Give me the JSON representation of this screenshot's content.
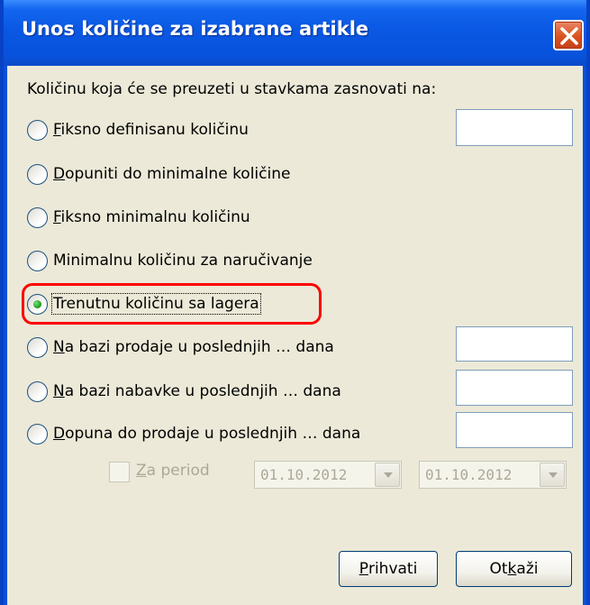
{
  "window": {
    "title": "Unos količine za izabrane artikle"
  },
  "header": {
    "label": "Količinu koja će se preuzeti u stavkama zasnovati na:"
  },
  "options": [
    {
      "mnemonic": "F",
      "rest": "iksno definisanu količinu",
      "selected": false,
      "has_input": true,
      "input_value": ""
    },
    {
      "mnemonic": "D",
      "rest": "opuniti do minimalne količine",
      "selected": false,
      "has_input": false
    },
    {
      "mnemonic": "F",
      "rest": "iksno minimalnu količinu",
      "selected": false,
      "has_input": false
    },
    {
      "mnemonic": "",
      "rest": "Minimalnu količinu za naručivanje",
      "selected": false,
      "has_input": false
    },
    {
      "mnemonic": "",
      "rest": "Trenutnu količinu sa lagera",
      "selected": true,
      "has_input": false
    },
    {
      "mnemonic": "N",
      "rest": "a bazi prodaje u poslednjih … dana",
      "selected": false,
      "has_input": true,
      "input_value": ""
    },
    {
      "mnemonic": "N",
      "rest": "a bazi nabavke u poslednjih … dana",
      "selected": false,
      "has_input": true,
      "input_value": ""
    },
    {
      "mnemonic": "D",
      "rest": "opuna do prodaje u poslednjih … dana",
      "selected": false,
      "has_input": true,
      "input_value": ""
    }
  ],
  "period": {
    "checkbox_mnemonic": "Z",
    "checkbox_rest": "a period",
    "checked": false,
    "enabled": false,
    "date_from": "01.10.2012",
    "date_to": "01.10.2012"
  },
  "buttons": {
    "accept_mnemonic": "P",
    "accept_rest": "rihvati",
    "cancel_pre": "Ot",
    "cancel_mnemonic": "k",
    "cancel_post": "aži"
  },
  "colors": {
    "titlebar": "#0a58e3",
    "client_bg": "#ece9d8",
    "highlight": "#ff0000",
    "close_button": "#d9531f",
    "radio_dot": "#21a121"
  }
}
